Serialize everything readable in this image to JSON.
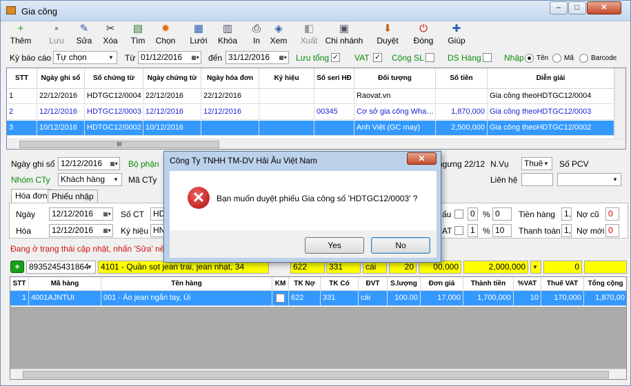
{
  "window": {
    "title": "Gia công",
    "min": "–",
    "max": "□",
    "close": "✕"
  },
  "toolbar": [
    {
      "name": "them-button",
      "label": "Thêm",
      "icon": "+",
      "color": "#1aa01a",
      "disabled": false
    },
    {
      "name": "luu-button",
      "label": "Lưu",
      "icon": "▪",
      "color": "#888",
      "disabled": true
    },
    {
      "name": "sua-button",
      "label": "Sửa",
      "icon": "✎",
      "color": "#2a5db0",
      "disabled": false
    },
    {
      "name": "xoa-button",
      "label": "Xóa",
      "icon": "✂",
      "color": "#333",
      "disabled": false
    },
    {
      "name": "tim-button",
      "label": "Tìm",
      "icon": "▤",
      "color": "#2a7a2a",
      "disabled": false
    },
    {
      "name": "chon-button",
      "label": "Chọn",
      "icon": "✹",
      "color": "#e07010",
      "disabled": false
    },
    {
      "name": "luoi-button",
      "label": "Lưới",
      "icon": "▦",
      "color": "#2a5db0",
      "disabled": false
    },
    {
      "name": "khoa-button",
      "label": "Khóa",
      "icon": "▥",
      "color": "#556",
      "disabled": false
    },
    {
      "name": "in-button",
      "label": "In",
      "icon": "⎙",
      "color": "#222",
      "disabled": false
    },
    {
      "name": "xem-button",
      "label": "Xem",
      "icon": "◈",
      "color": "#2a5db0",
      "disabled": false
    },
    {
      "name": "xuat-button",
      "label": "Xuất",
      "icon": "◧",
      "color": "#999",
      "disabled": true
    },
    {
      "name": "chi-nhanh-button",
      "label": "Chi nhánh",
      "icon": "▣",
      "color": "#556",
      "disabled": false
    },
    {
      "name": "duyet-button",
      "label": "Duyệt",
      "icon": "⬇",
      "color": "#c06010",
      "disabled": false
    },
    {
      "name": "dong-button",
      "label": "Đóng",
      "icon": "⏻",
      "color": "#d01010",
      "disabled": false
    },
    {
      "name": "giup-button",
      "label": "Giúp",
      "icon": "✚",
      "color": "#2a5db0",
      "disabled": false
    }
  ],
  "filter": {
    "ky_bao_cao_label": "Kỳ báo cáo",
    "ky_bao_cao_value": "Tự chọn",
    "tu_label": "Từ",
    "tu_value": "01/12/2016",
    "den_label": "đến",
    "den_value": "31/12/2016",
    "luu_tong_label": "Lưu tổng",
    "vat_label": "VAT",
    "cong_sl_label": "Cộng SL",
    "ds_hang_label": "DS Hàng",
    "nhap_label": "Nhập",
    "ten_label": "Tên",
    "ma_label": "Mã",
    "barcode_label": "Barcode"
  },
  "top_grid": {
    "headers": [
      "STT",
      "Ngày ghi sổ",
      "Số chứng từ",
      "Ngày chứng từ",
      "Ngày hóa đơn",
      "Ký hiệu",
      "Số seri HĐ",
      "Đối tượng",
      "Số tiền",
      "Diễn giải"
    ],
    "rows": [
      [
        "1",
        "22/12/2016",
        "HDTGC12/0004",
        "22/12/2016",
        "22/12/2016",
        "",
        "",
        "Raovat.vn",
        "",
        "Gia công theoHDTGC12/0004"
      ],
      [
        "2",
        "12/12/2016",
        "HDTGC12/0003",
        "12/12/2016",
        "12/12/2016",
        "",
        "00345",
        "Cơ sở gia công Wha…",
        "1,870,000",
        "Gia công theoHDTGC12/0003"
      ],
      [
        "3",
        "10/12/2016",
        "HDTGC12/0002",
        "10/12/2016",
        "",
        "",
        "",
        "Anh Việt (GC may)",
        "2,500,000",
        "Gia công theoHDTGC12/0002"
      ]
    ],
    "scroll_thumb": "III"
  },
  "form": {
    "ngay_ghi_so_label": "Ngày ghi sổ",
    "ngay_ghi_so_value": "12/12/2016",
    "bo_phan_label": "Bộ phận",
    "nhom_cty_label": "Nhóm CTy",
    "nhom_cty_value": "Khách hàng",
    "ma_cty_label": "Mã CTy",
    "ngung_value": "ngưng 22/12",
    "nvu_label": "N.Vụ",
    "nvu_value": "Thuê",
    "so_pcv_label": "Số PCV",
    "lien_he_label": "Liên hệ",
    "tab_hoa_don": "Hóa đơn",
    "tab_phieu_nhap": "Phiếu nhập",
    "ngay_label": "Ngày",
    "ngay_value": "12/12/2016",
    "so_ct_label": "Số CT",
    "so_ct_value": "HD",
    "hoa_label": "Hóa",
    "hoa_value": "12/12/2016",
    "ky_hieu_label": "Ký hiệu",
    "ky_hieu_value": "HN",
    "ck_label": "ấu",
    "ck_value": "0",
    "pct_sign": "%",
    "ck_pct": "0",
    "vat_label": "AT",
    "vat_value": "1",
    "vat_pct": "10",
    "tien_hang_label": "Tiền hàng",
    "tien_hang_value": "1,",
    "no_cu_label": "Nợ cũ",
    "no_cu_value": "0",
    "thanh_toan_label": "Thanh toán",
    "thanh_toan_value": "1,",
    "no_moi_label": "Nợ mới",
    "no_moi_value": "0",
    "status_text": "Đang ở trạng thái cập nhật, nhấn 'Sửa' nếu mu"
  },
  "entry": {
    "barcode": "8935245431864",
    "product": "4101 - Quần sọt jean trai, jean nhạt, 34",
    "tk_no": "622",
    "tk_co": "331",
    "dvt": "cái",
    "sl": "20",
    "thanh_tien": "00,000",
    "amount": "2,000,000",
    "vat": "0"
  },
  "bottom_grid": {
    "headers": [
      "STT",
      "Mã hàng",
      "Tên hàng",
      "KM",
      "TK Nợ",
      "TK Có",
      "ĐVT",
      "S.lượng",
      "Đơn giá",
      "Thành tiền",
      "%VAT",
      "Thuế VAT",
      "Tổng cộng"
    ],
    "rows": [
      [
        "1",
        "4001AJNTUI",
        "001 - Áo jean ngắn tay, Úi",
        "",
        "622",
        "331",
        "cái",
        "100.00",
        "17,000",
        "1,700,000",
        "10",
        "170,000",
        "1,870,00"
      ]
    ]
  },
  "dialog": {
    "title": "Công Ty TNHH TM-DV Hải Âu Việt Nam",
    "message": "Bạn muốn duyệt phiếu Gia công số 'HDTGC12/0003' ?",
    "yes": "Yes",
    "no": "No",
    "close": "✕",
    "icon": "✕"
  }
}
